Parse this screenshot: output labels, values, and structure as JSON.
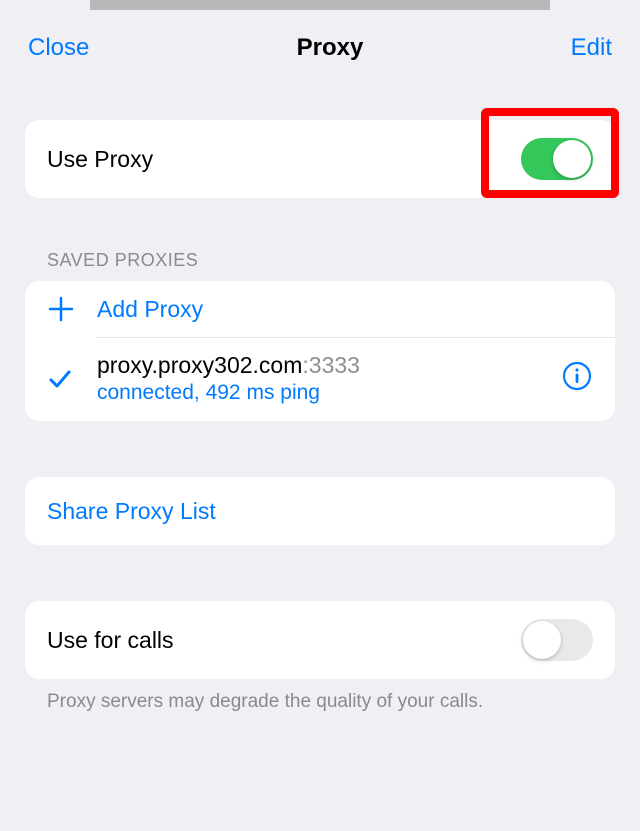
{
  "nav": {
    "close": "Close",
    "title": "Proxy",
    "edit": "Edit"
  },
  "useProxy": {
    "label": "Use Proxy",
    "enabled": true
  },
  "savedProxies": {
    "header": "SAVED PROXIES",
    "addLabel": "Add Proxy",
    "items": [
      {
        "host": "proxy.proxy302.com",
        "port": ":3333",
        "status": "connected, 492 ms ping",
        "selected": true
      }
    ]
  },
  "share": {
    "label": "Share Proxy List"
  },
  "calls": {
    "label": "Use for calls",
    "enabled": false,
    "note": "Proxy servers may degrade the quality of your calls."
  },
  "colors": {
    "accent": "#007aff",
    "toggleOn": "#34c759"
  }
}
